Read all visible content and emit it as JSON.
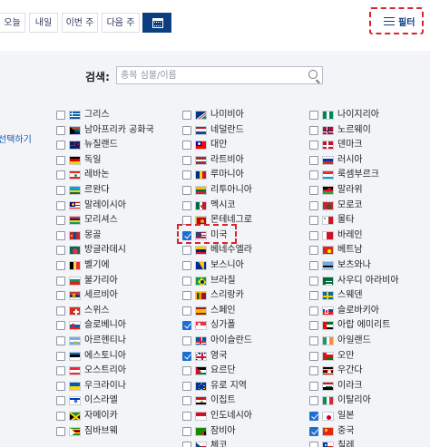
{
  "header": {
    "tabs": [
      {
        "label": "오늘"
      },
      {
        "label": "내일"
      },
      {
        "label": "이번 주"
      },
      {
        "label": "다음 주"
      }
    ],
    "filter_label": "필터"
  },
  "search": {
    "label": "검색:",
    "placeholder": "종목 심볼/이름"
  },
  "select_all_label": "선택하기",
  "countries": [
    {
      "name": "그리스",
      "checked": false,
      "flag": "greece"
    },
    {
      "name": "남아프리카 공화국",
      "checked": false,
      "flag": "southafrica"
    },
    {
      "name": "뉴질랜드",
      "checked": false,
      "flag": "newzealand"
    },
    {
      "name": "독일",
      "checked": false,
      "flag": "germany"
    },
    {
      "name": "레바논",
      "checked": false,
      "flag": "lebanon"
    },
    {
      "name": "르완다",
      "checked": false,
      "flag": "rwanda"
    },
    {
      "name": "말레이시아",
      "checked": false,
      "flag": "malaysia"
    },
    {
      "name": "모리셔스",
      "checked": false,
      "flag": "mauritius"
    },
    {
      "name": "몽골",
      "checked": false,
      "flag": "mongolia"
    },
    {
      "name": "방글라데시",
      "checked": false,
      "flag": "bangladesh"
    },
    {
      "name": "벨기에",
      "checked": false,
      "flag": "belgium"
    },
    {
      "name": "불가리아",
      "checked": false,
      "flag": "bulgaria"
    },
    {
      "name": "세르비아",
      "checked": false,
      "flag": "serbia"
    },
    {
      "name": "스위스",
      "checked": false,
      "flag": "switzerland"
    },
    {
      "name": "슬로베니아",
      "checked": false,
      "flag": "slovenia"
    },
    {
      "name": "아르헨티나",
      "checked": false,
      "flag": "argentina"
    },
    {
      "name": "에스토니아",
      "checked": false,
      "flag": "estonia"
    },
    {
      "name": "오스트리아",
      "checked": false,
      "flag": "austria"
    },
    {
      "name": "우크라이나",
      "checked": false,
      "flag": "ukraine"
    },
    {
      "name": "이스라엘",
      "checked": false,
      "flag": "israel"
    },
    {
      "name": "자메이카",
      "checked": false,
      "flag": "jamaica"
    },
    {
      "name": "짐바브웨",
      "checked": false,
      "flag": "zimbabwe"
    },
    {
      "name": "나미비아",
      "checked": false,
      "flag": "namibia"
    },
    {
      "name": "네덜란드",
      "checked": false,
      "flag": "netherlands"
    },
    {
      "name": "대만",
      "checked": false,
      "flag": "taiwan"
    },
    {
      "name": "라트비아",
      "checked": false,
      "flag": "latvia"
    },
    {
      "name": "루마니아",
      "checked": false,
      "flag": "romania"
    },
    {
      "name": "리투아니아",
      "checked": false,
      "flag": "lithuania"
    },
    {
      "name": "멕시코",
      "checked": false,
      "flag": "mexico"
    },
    {
      "name": "몬테네그로",
      "checked": false,
      "flag": "montenegro"
    },
    {
      "name": "미국",
      "checked": true,
      "flag": "usa"
    },
    {
      "name": "베네수엘라",
      "checked": false,
      "flag": "venezuela"
    },
    {
      "name": "보스니아",
      "checked": false,
      "flag": "bosnia"
    },
    {
      "name": "브라질",
      "checked": false,
      "flag": "brazil"
    },
    {
      "name": "스리랑카",
      "checked": false,
      "flag": "srilanka"
    },
    {
      "name": "스페인",
      "checked": false,
      "flag": "spain"
    },
    {
      "name": "싱가폴",
      "checked": true,
      "flag": "singapore"
    },
    {
      "name": "아이슬란드",
      "checked": false,
      "flag": "iceland"
    },
    {
      "name": "영국",
      "checked": true,
      "flag": "uk"
    },
    {
      "name": "요르단",
      "checked": false,
      "flag": "jordan"
    },
    {
      "name": "유로 지역",
      "checked": false,
      "flag": "eu"
    },
    {
      "name": "이집트",
      "checked": false,
      "flag": "egypt"
    },
    {
      "name": "인도네시아",
      "checked": false,
      "flag": "indonesia"
    },
    {
      "name": "잠비아",
      "checked": false,
      "flag": "zambia"
    },
    {
      "name": "체코",
      "checked": false,
      "flag": "czech"
    },
    {
      "name": "나이지리아",
      "checked": false,
      "flag": "nigeria"
    },
    {
      "name": "노르웨이",
      "checked": false,
      "flag": "norway"
    },
    {
      "name": "덴마크",
      "checked": false,
      "flag": "denmark"
    },
    {
      "name": "러시아",
      "checked": false,
      "flag": "russia"
    },
    {
      "name": "룩셈부르크",
      "checked": false,
      "flag": "luxembourg"
    },
    {
      "name": "말라위",
      "checked": false,
      "flag": "malawi"
    },
    {
      "name": "모로코",
      "checked": false,
      "flag": "morocco"
    },
    {
      "name": "몰타",
      "checked": false,
      "flag": "malta"
    },
    {
      "name": "바레인",
      "checked": false,
      "flag": "bahrain"
    },
    {
      "name": "베트남",
      "checked": false,
      "flag": "vietnam"
    },
    {
      "name": "보츠와나",
      "checked": false,
      "flag": "botswana"
    },
    {
      "name": "사우디 아라비아",
      "checked": false,
      "flag": "saudi"
    },
    {
      "name": "스웨덴",
      "checked": false,
      "flag": "sweden"
    },
    {
      "name": "슬로바키아",
      "checked": false,
      "flag": "slovakia"
    },
    {
      "name": "아랍 에미리트",
      "checked": false,
      "flag": "uae"
    },
    {
      "name": "아일랜드",
      "checked": false,
      "flag": "ireland"
    },
    {
      "name": "오만",
      "checked": false,
      "flag": "oman"
    },
    {
      "name": "우간다",
      "checked": false,
      "flag": "uganda"
    },
    {
      "name": "이라크",
      "checked": false,
      "flag": "iraq"
    },
    {
      "name": "이탈리아",
      "checked": false,
      "flag": "italy"
    },
    {
      "name": "일본",
      "checked": true,
      "flag": "japan"
    },
    {
      "name": "중국",
      "checked": true,
      "flag": "china"
    },
    {
      "name": "칠레",
      "checked": false,
      "flag": "chile"
    }
  ],
  "colors": {
    "accent": "#0d3f80",
    "checkbox_checked": "#1f6fd0",
    "highlight": "#d9242a",
    "panel_bg": "#f2f4f7"
  }
}
